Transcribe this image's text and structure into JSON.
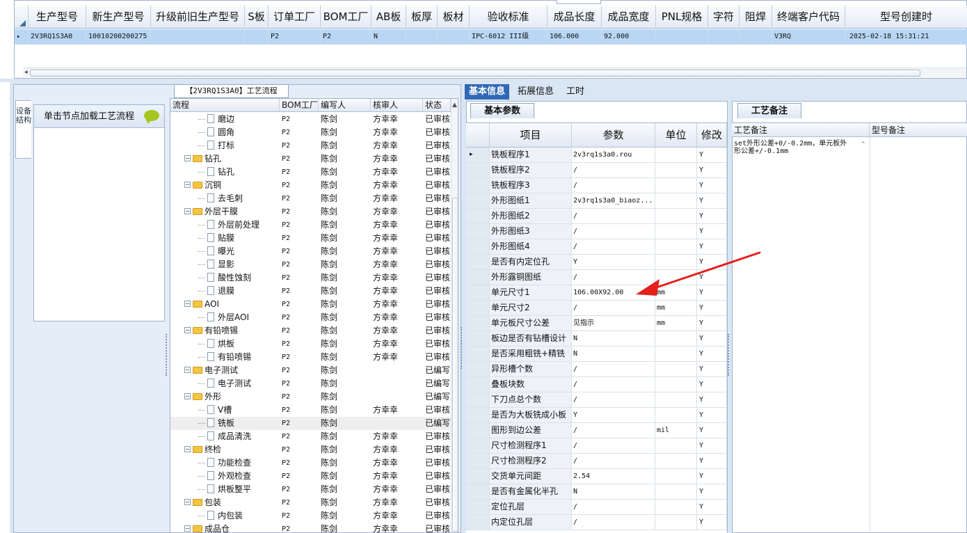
{
  "top_grid": {
    "columns": [
      "生产型号",
      "新生产型号",
      "升级前旧生产型号",
      "S板",
      "订单工厂",
      "BOM工厂",
      "AB板",
      "板厚",
      "板材",
      "验收标准",
      "成品长度",
      "成品宽度",
      "PNL规格",
      "字符",
      "阻焊",
      "终端客户代码",
      "型号创建时"
    ],
    "row": {
      "生产型号": "2V3RQ1S3A0",
      "新生产型号": "10010200200275",
      "升级前旧生产型号": "",
      "S板": "",
      "订单工厂": "P2",
      "BOM工厂": "P2",
      "AB板": "N",
      "板厚": "",
      "板材": "",
      "验收标准": "IPC-6012 III级",
      "成品长度": "106.000",
      "成品宽度": "92.000",
      "PNL规格": "",
      "字符": "",
      "阻焊": "",
      "终端客户代码": "V3RQ",
      "型号创建时": "2025-02-18 15:31:21"
    }
  },
  "left_tab": {
    "vertical_label": "设备结构"
  },
  "node_panel": {
    "header": "单击节点加载工艺流程",
    "icon": "chat-bubble-icon"
  },
  "process_flow": {
    "title": "【2V3RQ1S3A0】工艺流程",
    "columns": [
      "流程",
      "BOM工厂",
      "编写人",
      "核审人",
      "状态"
    ],
    "rows": [
      {
        "level": 2,
        "type": "doc",
        "name": "磨边",
        "bom": "P2",
        "writer": "陈剑",
        "reviewer": "方幸幸",
        "status": "已审核"
      },
      {
        "level": 2,
        "type": "doc",
        "name": "圆角",
        "bom": "P2",
        "writer": "陈剑",
        "reviewer": "方幸幸",
        "status": "已审核"
      },
      {
        "level": 2,
        "type": "doc",
        "name": "打标",
        "bom": "P2",
        "writer": "陈剑",
        "reviewer": "方幸幸",
        "status": "已审核"
      },
      {
        "level": 1,
        "type": "folder",
        "name": "钻孔",
        "bom": "P2",
        "writer": "陈剑",
        "reviewer": "方幸幸",
        "status": "已审核"
      },
      {
        "level": 2,
        "type": "doc",
        "name": "钻孔",
        "bom": "P2",
        "writer": "陈剑",
        "reviewer": "方幸幸",
        "status": "已审核"
      },
      {
        "level": 1,
        "type": "folder",
        "name": "沉铜",
        "bom": "P2",
        "writer": "陈剑",
        "reviewer": "方幸幸",
        "status": "已审核"
      },
      {
        "level": 2,
        "type": "doc",
        "name": "去毛刺",
        "bom": "P2",
        "writer": "陈剑",
        "reviewer": "方幸幸",
        "status": "已审核"
      },
      {
        "level": 1,
        "type": "folder",
        "name": "外层干膜",
        "bom": "P2",
        "writer": "陈剑",
        "reviewer": "方幸幸",
        "status": "已审核"
      },
      {
        "level": 2,
        "type": "doc",
        "name": "外层前处理",
        "bom": "P2",
        "writer": "陈剑",
        "reviewer": "方幸幸",
        "status": "已审核"
      },
      {
        "level": 2,
        "type": "doc",
        "name": "贴膜",
        "bom": "P2",
        "writer": "陈剑",
        "reviewer": "方幸幸",
        "status": "已审核"
      },
      {
        "level": 2,
        "type": "doc",
        "name": "曝光",
        "bom": "P2",
        "writer": "陈剑",
        "reviewer": "方幸幸",
        "status": "已审核"
      },
      {
        "level": 2,
        "type": "doc",
        "name": "显影",
        "bom": "P2",
        "writer": "陈剑",
        "reviewer": "方幸幸",
        "status": "已审核"
      },
      {
        "level": 2,
        "type": "doc",
        "name": "酸性蚀刻",
        "bom": "P2",
        "writer": "陈剑",
        "reviewer": "方幸幸",
        "status": "已审核"
      },
      {
        "level": 2,
        "type": "doc",
        "name": "退膜",
        "bom": "P2",
        "writer": "陈剑",
        "reviewer": "方幸幸",
        "status": "已审核"
      },
      {
        "level": 1,
        "type": "folder",
        "name": "AOI",
        "bom": "P2",
        "writer": "陈剑",
        "reviewer": "方幸幸",
        "status": "已审核"
      },
      {
        "level": 2,
        "type": "doc",
        "name": "外层AOI",
        "bom": "P2",
        "writer": "陈剑",
        "reviewer": "方幸幸",
        "status": "已审核"
      },
      {
        "level": 1,
        "type": "folder",
        "name": "有铅喷锡",
        "bom": "P2",
        "writer": "陈剑",
        "reviewer": "方幸幸",
        "status": "已审核"
      },
      {
        "level": 2,
        "type": "doc",
        "name": "烘板",
        "bom": "P2",
        "writer": "陈剑",
        "reviewer": "方幸幸",
        "status": "已审核"
      },
      {
        "level": 2,
        "type": "doc",
        "name": "有铅喷锡",
        "bom": "P2",
        "writer": "陈剑",
        "reviewer": "方幸幸",
        "status": "已审核"
      },
      {
        "level": 1,
        "type": "folder",
        "name": "电子测试",
        "bom": "P2",
        "writer": "陈剑",
        "reviewer": "",
        "status": "已编写"
      },
      {
        "level": 2,
        "type": "doc",
        "name": "电子测试",
        "bom": "P2",
        "writer": "陈剑",
        "reviewer": "",
        "status": "已编写"
      },
      {
        "level": 1,
        "type": "folder",
        "name": "外形",
        "bom": "P2",
        "writer": "陈剑",
        "reviewer": "",
        "status": "已编写"
      },
      {
        "level": 2,
        "type": "doc",
        "name": "V槽",
        "bom": "P2",
        "writer": "陈剑",
        "reviewer": "方幸幸",
        "status": "已审核"
      },
      {
        "level": 2,
        "type": "doc",
        "name": "铣板",
        "bom": "P2",
        "writer": "陈剑",
        "reviewer": "",
        "status": "已编写",
        "selected": true
      },
      {
        "level": 2,
        "type": "doc",
        "name": "成品清洗",
        "bom": "P2",
        "writer": "陈剑",
        "reviewer": "方幸幸",
        "status": "已审核"
      },
      {
        "level": 1,
        "type": "folder",
        "name": "终检",
        "bom": "P2",
        "writer": "陈剑",
        "reviewer": "方幸幸",
        "status": "已审核"
      },
      {
        "level": 2,
        "type": "doc",
        "name": "功能检查",
        "bom": "P2",
        "writer": "陈剑",
        "reviewer": "方幸幸",
        "status": "已审核"
      },
      {
        "level": 2,
        "type": "doc",
        "name": "外观检查",
        "bom": "P2",
        "writer": "陈剑",
        "reviewer": "方幸幸",
        "status": "已审核"
      },
      {
        "level": 2,
        "type": "doc",
        "name": "烘板整平",
        "bom": "P2",
        "writer": "陈剑",
        "reviewer": "方幸幸",
        "status": "已审核"
      },
      {
        "level": 1,
        "type": "folder",
        "name": "包装",
        "bom": "P2",
        "writer": "陈剑",
        "reviewer": "方幸幸",
        "status": "已审核"
      },
      {
        "level": 2,
        "type": "doc",
        "name": "内包装",
        "bom": "P2",
        "writer": "陈剑",
        "reviewer": "方幸幸",
        "status": "已审核"
      },
      {
        "level": 1,
        "type": "folder",
        "name": "成品仓",
        "bom": "P2",
        "writer": "陈剑",
        "reviewer": "方幸幸",
        "status": "已审核"
      }
    ]
  },
  "mid_tabs": [
    "基本信息",
    "拓展信息",
    "工时"
  ],
  "basic_params": {
    "subtab": "基本参数",
    "columns": [
      "项目",
      "参数",
      "单位",
      "修改"
    ],
    "rows": [
      {
        "item": "铣板程序1",
        "param": "2v3rq1s3a0.rou",
        "unit": "",
        "mod": "Y",
        "current": true
      },
      {
        "item": "铣板程序2",
        "param": "/",
        "unit": "",
        "mod": "Y"
      },
      {
        "item": "铣板程序3",
        "param": "/",
        "unit": "",
        "mod": "Y"
      },
      {
        "item": "外形图纸1",
        "param": "2v3rq1s3a0_biaoz...",
        "unit": "",
        "mod": "Y"
      },
      {
        "item": "外形图纸2",
        "param": "/",
        "unit": "",
        "mod": "Y"
      },
      {
        "item": "外形图纸3",
        "param": "/",
        "unit": "",
        "mod": "Y"
      },
      {
        "item": "外形图纸4",
        "param": "/",
        "unit": "",
        "mod": "Y"
      },
      {
        "item": "是否有内定位孔",
        "param": "Y",
        "unit": "",
        "mod": "Y"
      },
      {
        "item": "外形露铜图纸",
        "param": "/",
        "unit": "",
        "mod": "Y"
      },
      {
        "item": "单元尺寸1",
        "param": "106.00X92.00",
        "unit": "mm",
        "mod": "Y"
      },
      {
        "item": "单元尺寸2",
        "param": "/",
        "unit": "mm",
        "mod": "Y"
      },
      {
        "item": "单元板尺寸公差",
        "param": "见指示",
        "unit": "mm",
        "mod": "Y"
      },
      {
        "item": "板边是否有钻槽设计",
        "param": "N",
        "unit": "",
        "mod": "Y"
      },
      {
        "item": "是否采用粗铣+精铣",
        "param": "N",
        "unit": "",
        "mod": "Y"
      },
      {
        "item": "异形槽个数",
        "param": "/",
        "unit": "",
        "mod": "Y"
      },
      {
        "item": "叠板块数",
        "param": "/",
        "unit": "",
        "mod": "Y"
      },
      {
        "item": "下刀点总个数",
        "param": "/",
        "unit": "",
        "mod": "Y"
      },
      {
        "item": "是否为大板铣成小板",
        "param": "Y",
        "unit": "",
        "mod": "Y"
      },
      {
        "item": "图形到边公差",
        "param": "/",
        "unit": "mil",
        "mod": "Y"
      },
      {
        "item": "尺寸检测程序1",
        "param": "/",
        "unit": "",
        "mod": "Y"
      },
      {
        "item": "尺寸检测程序2",
        "param": "/",
        "unit": "",
        "mod": "Y"
      },
      {
        "item": "交货单元间距",
        "param": "2.54",
        "unit": "",
        "mod": "Y"
      },
      {
        "item": "是否有金属化半孔",
        "param": "N",
        "unit": "",
        "mod": "Y"
      },
      {
        "item": "定位孔层",
        "param": "/",
        "unit": "",
        "mod": "Y"
      },
      {
        "item": "内定位孔层",
        "param": "/",
        "unit": "",
        "mod": "Y"
      }
    ]
  },
  "process_notes": {
    "tab": "工艺备注",
    "columns": [
      "工艺备注",
      "型号备注"
    ],
    "note": "set外形公差+0/-0.2mm，单元板外形公差+/-0.1mm"
  },
  "colors": {
    "selected_row": "#b9d7f5",
    "active_tab": "#2f69b6",
    "annotation_arrow": "#e3201b",
    "folder": "#f4c542",
    "bubble": "#a4c621"
  }
}
